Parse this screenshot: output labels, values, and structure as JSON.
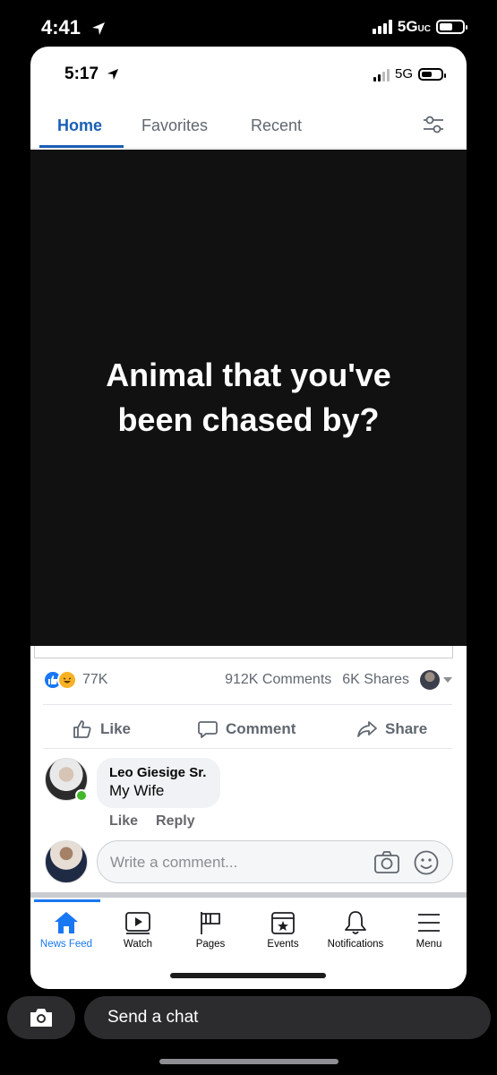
{
  "outer_status": {
    "time": "4:41",
    "network": "5G",
    "network_suffix": "UC"
  },
  "inner_status": {
    "time": "5:17",
    "network": "5G"
  },
  "tabs": [
    {
      "label": "Home",
      "active": true
    },
    {
      "label": "Favorites",
      "active": false
    },
    {
      "label": "Recent",
      "active": false
    }
  ],
  "post": {
    "image_caption": "Animal that you've been chased by?",
    "reaction_count": "77K",
    "comments": "912K Comments",
    "shares": "6K Shares",
    "actions": {
      "like": "Like",
      "comment": "Comment",
      "share": "Share"
    }
  },
  "comment": {
    "author": "Leo Giesige Sr.",
    "text": "My Wife",
    "like": "Like",
    "reply": "Reply"
  },
  "composer": {
    "placeholder": "Write a comment..."
  },
  "bottom_nav": [
    {
      "label": "News Feed",
      "icon": "home-icon",
      "active": true
    },
    {
      "label": "Watch",
      "icon": "watch-icon",
      "active": false
    },
    {
      "label": "Pages",
      "icon": "flag-icon",
      "active": false
    },
    {
      "label": "Events",
      "icon": "calendar-star-icon",
      "active": false
    },
    {
      "label": "Notifications",
      "icon": "bell-icon",
      "active": false
    },
    {
      "label": "Menu",
      "icon": "hamburger-icon",
      "active": false
    }
  ],
  "snapchat": {
    "send_chat": "Send a chat"
  },
  "colors": {
    "accent": "#1877f2",
    "tab_active": "#1a5fb4",
    "post_bg": "#111111",
    "online": "#42b72a"
  }
}
